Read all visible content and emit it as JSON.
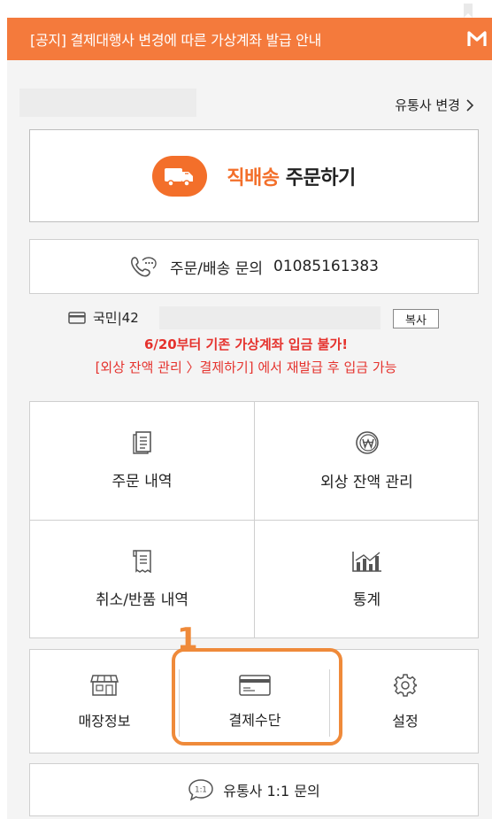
{
  "notice": {
    "text": "[공지] 결제대행사 변경에 따른 가상계좌 발급 안내",
    "icon": "m-logo-icon"
  },
  "header": {
    "change_link": "유통사 변경",
    "change_icon": "chevron-right-icon"
  },
  "order": {
    "accent": "직배송",
    "rest": "주문하기",
    "icon": "truck-icon"
  },
  "phone": {
    "label": "주문/배송 문의",
    "number": "01085161383",
    "icon": "phone-icon"
  },
  "bank": {
    "text": "국민|42",
    "copy_label": "복사",
    "icon": "card-icon",
    "warning1": "6/20부터 기존 가상계좌 입금 불가!",
    "warning2": "[외상 잔액 관리 〉결제하기] 에서 재발급 후 입금 가능"
  },
  "menu": [
    {
      "label": "주문 내역",
      "icon": "document-icon"
    },
    {
      "label": "외상 잔액 관리",
      "icon": "won-coin-icon"
    },
    {
      "label": "취소/반품 내역",
      "icon": "receipt-icon"
    },
    {
      "label": "통계",
      "icon": "chart-icon"
    }
  ],
  "tools": [
    {
      "label": "매장정보",
      "icon": "store-icon"
    },
    {
      "label": "결제수단",
      "icon": "card-icon"
    },
    {
      "label": "설정",
      "icon": "gear-icon"
    }
  ],
  "annotation": {
    "step": "1"
  },
  "inquiry": {
    "label": "유통사 1:1 문의",
    "icon": "chat-bubble-icon",
    "icon_text": "1:1"
  },
  "colors": {
    "accent": "#f47a3c",
    "warning": "#e5322d",
    "highlight": "#ef8a3a"
  }
}
